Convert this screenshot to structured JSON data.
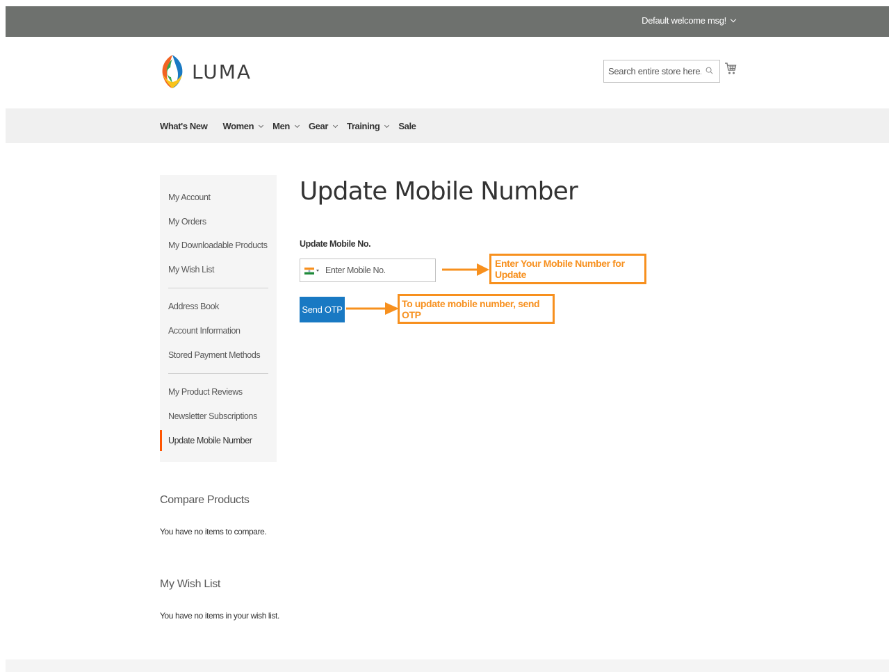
{
  "header": {
    "welcome": "Default welcome msg!"
  },
  "logo": {
    "text": "LUMA"
  },
  "search": {
    "placeholder": "Search entire store here..."
  },
  "nav": {
    "items": [
      {
        "label": "What's New",
        "dropdown": false
      },
      {
        "label": "Women",
        "dropdown": true
      },
      {
        "label": "Men",
        "dropdown": true
      },
      {
        "label": "Gear",
        "dropdown": true
      },
      {
        "label": "Training",
        "dropdown": true
      },
      {
        "label": "Sale",
        "dropdown": false
      }
    ]
  },
  "sidebar": {
    "items": [
      {
        "label": "My Account"
      },
      {
        "label": "My Orders"
      },
      {
        "label": "My Downloadable Products"
      },
      {
        "label": "My Wish List"
      },
      {
        "label": "Address Book"
      },
      {
        "label": "Account Information"
      },
      {
        "label": "Stored Payment Methods"
      },
      {
        "label": "My Product Reviews"
      },
      {
        "label": "Newsletter Subscriptions"
      },
      {
        "label": "Update Mobile Number",
        "active": true
      }
    ]
  },
  "compare": {
    "title": "Compare Products",
    "text": "You have no items to compare."
  },
  "wishlist": {
    "title": "My Wish List",
    "text": "You have no items in your wish list."
  },
  "main": {
    "title": "Update Mobile Number",
    "field_label": "Update Mobile No.",
    "phone_placeholder": "Enter Mobile No.",
    "send_otp": "Send OTP"
  },
  "annotations": {
    "mobile_callout": "Enter Your Mobile Number for Update",
    "otp_callout": "To update mobile number, send OTP"
  },
  "colors": {
    "header_bg": "#6e716e",
    "nav_bg": "#f0f0f0",
    "primary_button": "#1979c3",
    "active_accent": "#ff5501",
    "callout": "#f7901e"
  }
}
